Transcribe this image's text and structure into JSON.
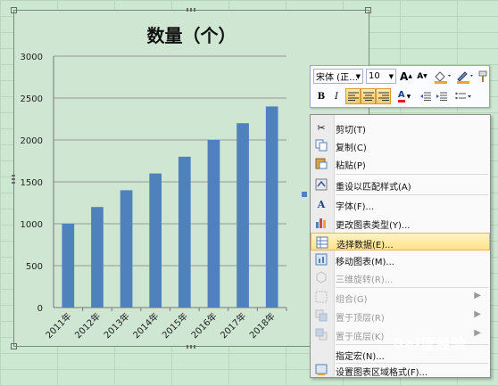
{
  "chart_data": {
    "type": "bar",
    "title": "数量（个）",
    "categories": [
      "2011年",
      "2012年",
      "2013年",
      "2014年",
      "2015年",
      "2016年",
      "2017年",
      "2018年"
    ],
    "values": [
      1000,
      1200,
      1400,
      1600,
      1800,
      2000,
      2200,
      2400
    ],
    "ylim": [
      0,
      3000
    ],
    "yticks": [
      "0",
      "500",
      "1000",
      "1500",
      "2000",
      "2500",
      "3000"
    ],
    "grid": true,
    "bar_color": "#4f81bd"
  },
  "mini_toolbar": {
    "font_name": "宋体 (正…",
    "font_size": "10",
    "grow_font": "A",
    "shrink_font": "A",
    "bold": "B",
    "italic": "I",
    "font_color": "A"
  },
  "context_menu": {
    "items": [
      {
        "label": "剪切(T)",
        "icon": "scissors-icon",
        "enabled": true
      },
      {
        "label": "复制(C)",
        "icon": "copy-icon",
        "enabled": true
      },
      {
        "label": "粘贴(P)",
        "icon": "paste-icon",
        "enabled": true
      },
      {
        "label": "重设以匹配样式(A)",
        "icon": "reset-style-icon",
        "enabled": true
      },
      {
        "label": "字体(F)...",
        "icon": "font-icon",
        "enabled": true
      },
      {
        "label": "更改图表类型(Y)...",
        "icon": "chart-type-icon",
        "enabled": true
      },
      {
        "label": "选择数据(E)...",
        "icon": "select-data-icon",
        "enabled": true,
        "highlighted": true
      },
      {
        "label": "移动图表(M)...",
        "icon": "move-chart-icon",
        "enabled": true
      },
      {
        "label": "三维旋转(R)...",
        "icon": "rotate-3d-icon",
        "enabled": false
      },
      {
        "label": "组合(G)",
        "icon": "group-icon",
        "enabled": false,
        "submenu": true
      },
      {
        "label": "置于顶层(R)",
        "icon": "bring-front-icon",
        "enabled": false,
        "submenu": true
      },
      {
        "label": "置于底层(K)",
        "icon": "send-back-icon",
        "enabled": false,
        "submenu": true
      },
      {
        "label": "指定宏(N)...",
        "icon": "macro-icon",
        "enabled": true
      },
      {
        "label": "设置图表区域格式(F)...",
        "icon": "format-chart-area-icon",
        "enabled": true
      }
    ]
  },
  "watermark": "Bai度经验",
  "colors": {
    "sheet": "#cde8d0",
    "chart_bg": "#cfe6d3",
    "highlight": "#ffe18a"
  }
}
